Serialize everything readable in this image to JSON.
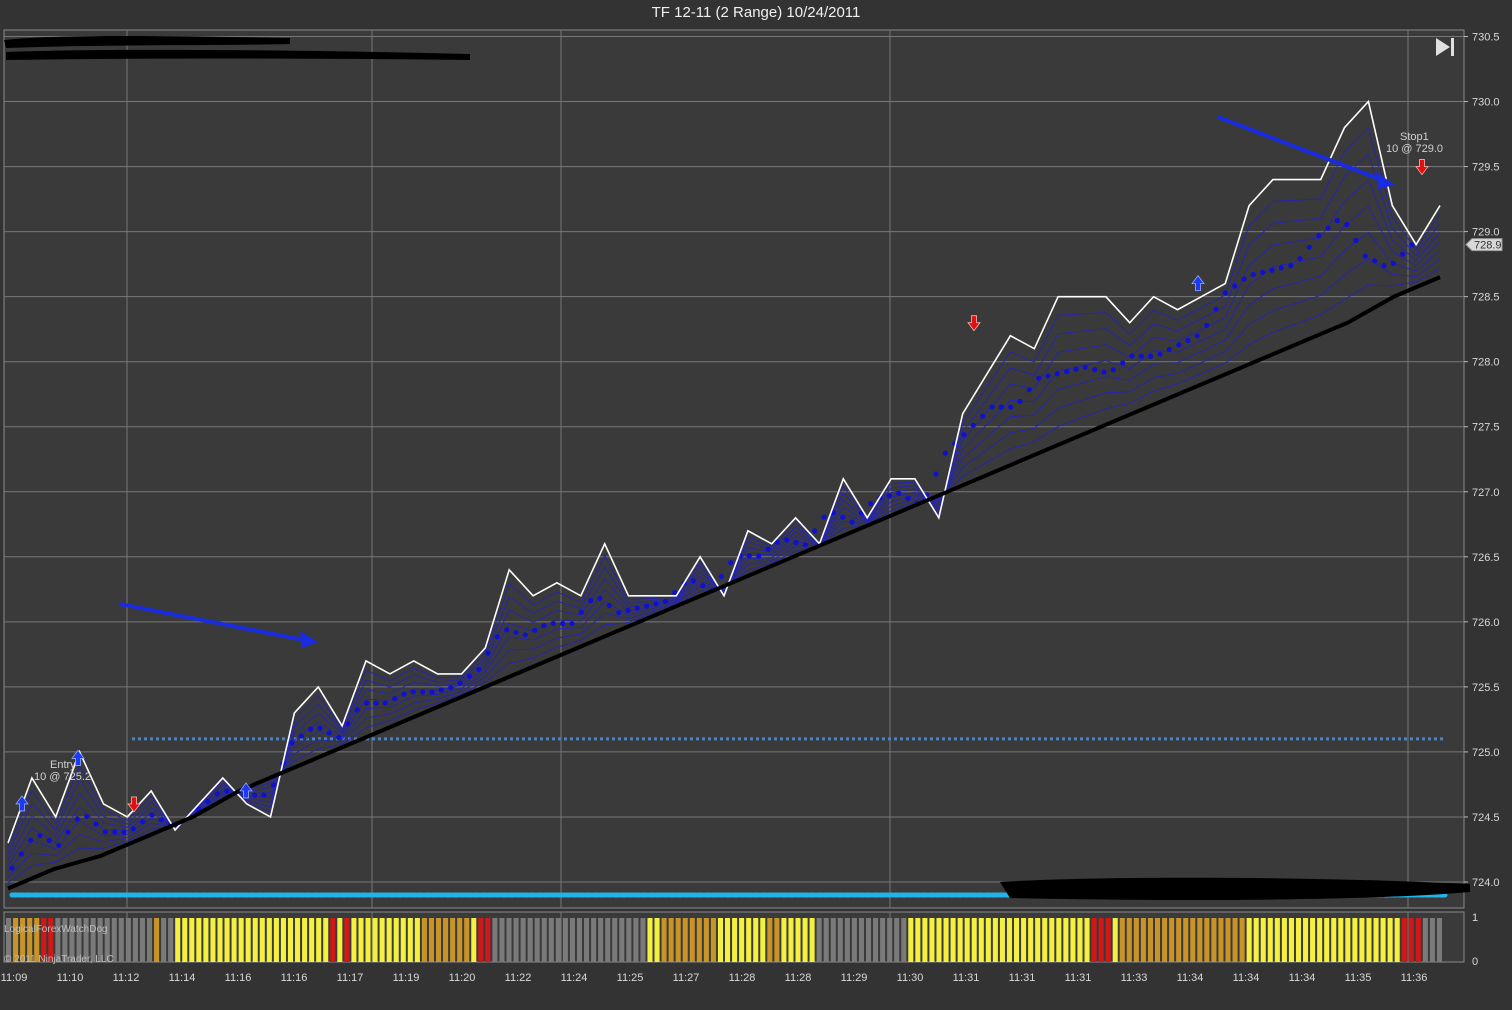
{
  "window": {
    "title": "TF 12-11 (2 Range)  10/24/2011"
  },
  "colors": {
    "background": "#3a3a3a",
    "grid": "#777777",
    "price": "#ffffff",
    "band": "#2424b8",
    "trend": "#000000",
    "dots": "#1010d0",
    "level_line_upper": "#4a84c4",
    "level_line_lower": "#22b4e8",
    "up_arrow": "#1a3cf0",
    "down_arrow": "#e01010",
    "annotation_arrow": "#1a2ce0",
    "bar_yellow": "#f4f040",
    "bar_orange": "#c89428",
    "bar_red": "#d01818",
    "bar_gray": "#7a7a7a"
  },
  "icons": {
    "scroll_end": "skip-to-end-icon"
  },
  "chart_data": {
    "type": "line",
    "title": "TF 12-11 (2 Range)  10/24/2011",
    "ylim": [
      723.8,
      730.55
    ],
    "y_ticks": [
      "730.5",
      "730.0",
      "729.5",
      "729.0",
      "728.5",
      "728.0",
      "727.5",
      "727.0",
      "726.5",
      "726.0",
      "725.5",
      "725.0",
      "724.5",
      "724.0"
    ],
    "x_tick_labels": [
      "11:09",
      "11:10",
      "11:12",
      "11:14",
      "11:16",
      "11:16",
      "11:17",
      "11:19",
      "11:20",
      "11:22",
      "11:24",
      "11:25",
      "11:27",
      "11:28",
      "11:28",
      "11:29",
      "11:30",
      "11:31",
      "11:31",
      "11:31",
      "11:33",
      "11:34",
      "11:34",
      "11:34",
      "11:35",
      "11:36"
    ],
    "grid": true,
    "series": [
      {
        "name": "",
        "values": [
          724.3,
          724.8,
          724.5,
          725.0,
          724.6,
          724.5,
          724.7,
          724.4,
          724.6,
          724.8,
          724.6,
          724.5,
          725.3,
          725.5,
          725.2,
          725.7,
          725.6,
          725.7,
          725.6,
          725.6,
          725.8,
          726.4,
          726.2,
          726.3,
          726.2,
          726.6,
          726.2,
          726.2,
          726.2,
          726.5,
          726.2,
          726.7,
          726.6,
          726.8,
          726.6,
          727.1,
          726.8,
          727.1,
          727.1,
          726.8,
          727.6,
          727.9,
          728.2,
          728.1,
          728.5,
          728.5,
          728.5,
          728.3,
          728.5,
          728.4,
          728.5,
          728.6,
          729.2,
          729.4,
          729.4,
          729.4,
          729.8,
          730.0,
          729.2,
          728.9,
          729.2
        ]
      },
      {
        "name": "",
        "values": [
          723.95,
          724.1,
          724.2,
          724.35,
          724.5,
          724.7,
          724.85,
          725.0,
          725.15,
          725.3,
          725.45,
          725.6,
          725.75,
          725.9,
          726.05,
          726.2,
          726.35,
          726.5,
          726.65,
          726.8,
          726.95,
          727.1,
          727.25,
          727.4,
          727.55,
          727.7,
          727.85,
          728.0,
          728.15,
          728.3,
          728.5,
          728.65
        ]
      }
    ],
    "levels": [
      725.1,
      723.9
    ],
    "markers": [
      {
        "type": "up-arrow",
        "x": "11:09",
        "y": 724.6
      },
      {
        "type": "up-arrow",
        "x": "11:10",
        "y": 724.95
      },
      {
        "type": "down-arrow",
        "x": "11:12",
        "y": 724.6
      },
      {
        "type": "up-arrow",
        "x": "11:16",
        "y": 724.7
      },
      {
        "type": "down-arrow",
        "x": "11:31",
        "y": 728.3
      },
      {
        "type": "up-arrow",
        "x": "11:34",
        "y": 728.6
      },
      {
        "type": "down-arrow",
        "x": "11:36",
        "y": 729.5
      }
    ],
    "annotations": [
      {
        "label": "Entry",
        "value": "10 @ 725.2"
      },
      {
        "label": "Stop1",
        "value": "10 @ 729.0"
      }
    ],
    "current_price": "728.9",
    "indicator": {
      "name": "LogicalForexWatchDog",
      "ylim": [
        0,
        1
      ],
      "y_ticks": [
        "1",
        "0"
      ],
      "pattern": "GOOOORRGGGGGGGGGGGGGGOGGYYYYYYYYYYYYYYYYYYYYYYRYRYYYYYYYYYYOOOOOOOYRRGGGGGGGGGGGGGGGGGGGGGGYYOOOOOOOOYYYYYYYOOYYYYYGGGGGGGGGGGGGYYYYYYYYYYYYYYYYYYYYYYYYYYRRRYOOOOOOOOOOOOOOOOOOYYYYYYYYYYYYYYYYYYYYYYRRRGGG"
    }
  },
  "footer": {
    "copyright": "© 2011 NinjaTrader, LLC"
  }
}
